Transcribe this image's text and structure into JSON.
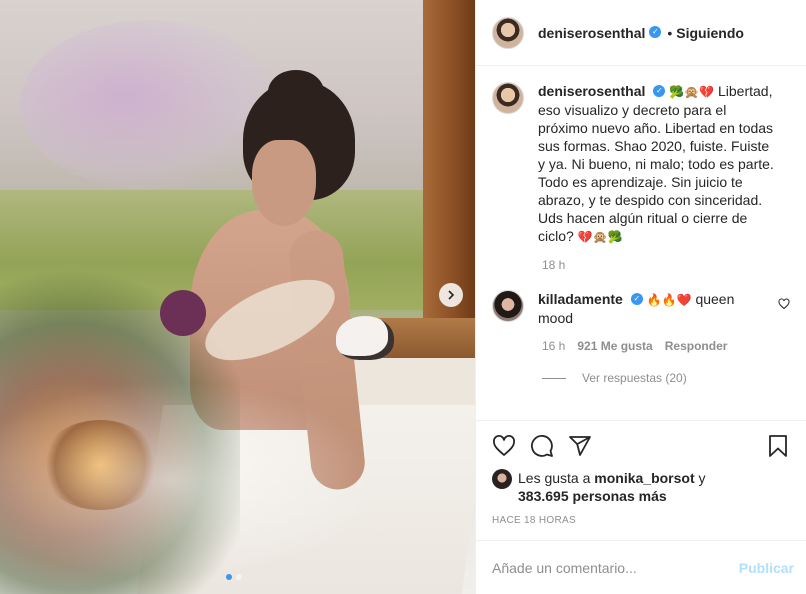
{
  "post": {
    "author": {
      "username": "deniserosenthal",
      "verified_icon": "verified-badge-icon",
      "follow_state": "Siguiendo",
      "separator": "•"
    },
    "caption": {
      "username": "deniserosenthal",
      "emoji_prefix": "🥦🙊💔",
      "text": "Libertad, eso visualizo y decreto para el próximo nuevo año. Libertad en todas sus formas. Shao 2020, fuiste. Fuiste y ya. Ni bueno, ni malo; todo es parte. Todo es aprendizaje. Sin juicio te abrazo, y te despido con sinceridad. Uds hacen algún ritual o cierre de ciclo?",
      "emoji_suffix": "💔🙊🥦",
      "timestamp": "18 h"
    },
    "comments": [
      {
        "username": "killadamente",
        "emoji": "🔥🔥❤️",
        "text": "queen mood",
        "time": "16 h",
        "likes": "921 Me gusta",
        "reply_label": "Responder",
        "view_replies": "Ver respuestas (20)"
      }
    ],
    "likes": {
      "prefix": "Les gusta a",
      "user": "monika_borsot",
      "joiner": "y",
      "count": "383.695 personas más"
    },
    "posted_ago": "HACE 18 HORAS",
    "comment_box": {
      "placeholder": "Añade un comentario...",
      "submit_label": "Publicar"
    },
    "carousel": {
      "current": 1,
      "total": 2
    }
  },
  "colors": {
    "accent": "#3897f0",
    "text": "#262626",
    "muted": "#8e8e8e",
    "publish_disabled": "#b2dffc",
    "border": "#efefef"
  },
  "icons": [
    "heart-icon",
    "comment-icon",
    "share-icon",
    "bookmark-icon",
    "chevron-right-icon",
    "verified-badge-icon"
  ]
}
